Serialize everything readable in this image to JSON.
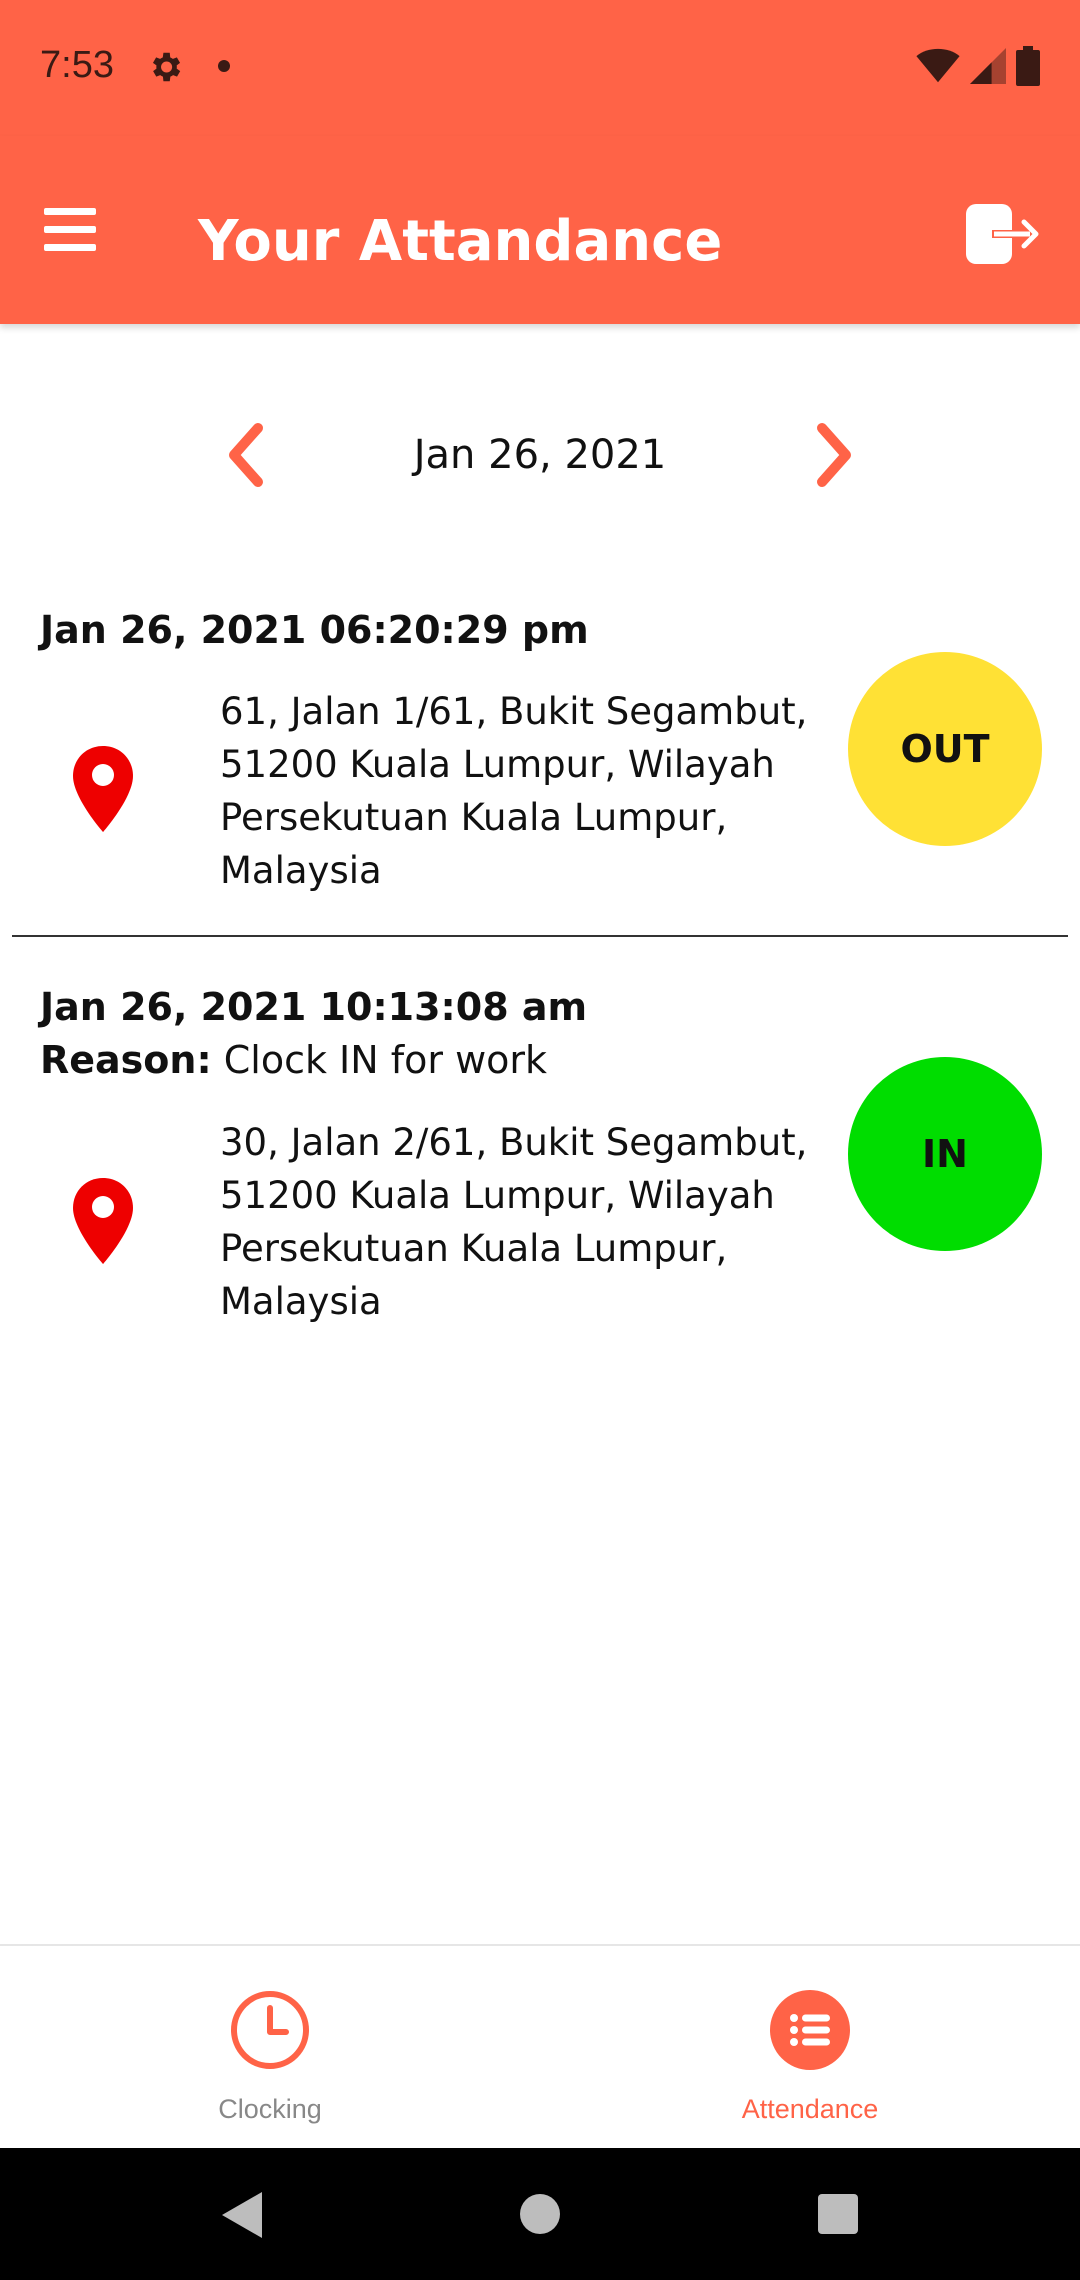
{
  "status_bar": {
    "time": "7:53"
  },
  "app_bar": {
    "title": "Your Attandance"
  },
  "date_nav": {
    "current_date": "Jan 26, 2021"
  },
  "records": [
    {
      "timestamp": "Jan 26, 2021 06:20:29 pm",
      "address": "61, Jalan 1/61, Bukit Segambut, 51200 Kuala Lumpur, Wilayah Persekutuan Kuala Lumpur, Malaysia",
      "type": "OUT",
      "color": "#ffe135"
    },
    {
      "timestamp": "Jan 26, 2021 10:13:08 am",
      "reason_label": "Reason:",
      "reason": " Clock IN for work",
      "address": "30, Jalan 2/61, Bukit Segambut, 51200 Kuala Lumpur, Wilayah Persekutuan Kuala Lumpur, Malaysia",
      "type": "IN",
      "color": "#00dd00"
    }
  ],
  "bottom_nav": [
    {
      "label": "Clocking",
      "icon": "clock-icon",
      "active": false
    },
    {
      "label": "Attendance",
      "icon": "list-icon",
      "active": true
    }
  ],
  "colors": {
    "primary": "#ff6347",
    "pin": "#ee0000",
    "inactive": "#888888"
  }
}
